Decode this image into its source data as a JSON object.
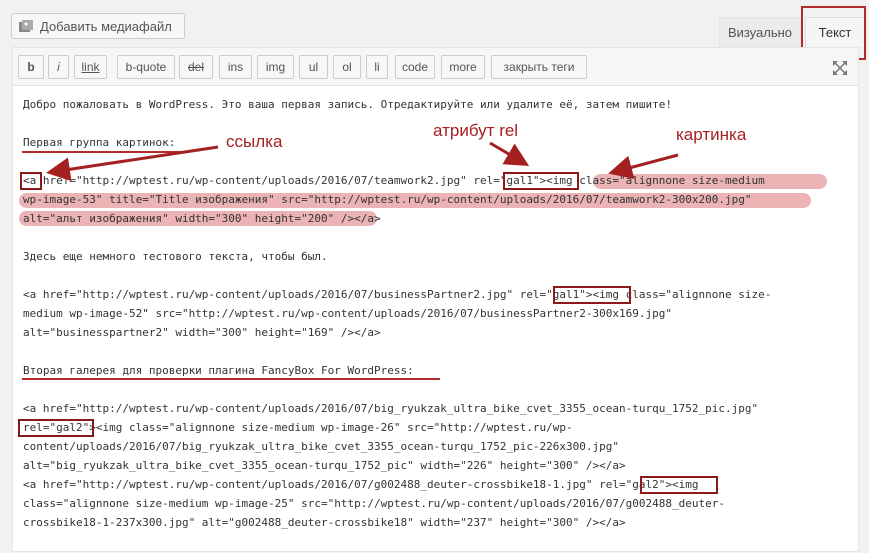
{
  "media_button": {
    "label": "Добавить медиафайл",
    "icon": "media-icon"
  },
  "tabs": [
    {
      "label": "Визуально"
    },
    {
      "label": "Текст"
    }
  ],
  "toolbar": {
    "buttons": [
      "b",
      "i",
      "link",
      "b-quote",
      "del",
      "ins",
      "img",
      "ul",
      "ol",
      "li",
      "code",
      "more",
      "закрыть теги"
    ]
  },
  "content": {
    "lines": [
      "Добро пожаловать в WordPress. Это ваша первая запись. Отредактируйте или удалите её, затем пишите!",
      "Первая группа картинок:",
      "<a href=\"http://wptest.ru/wp-content/uploads/2016/07/teamwork2.jpg\" rel=\"gal1\"><img class=\"alignnone size-medium",
      "wp-image-53\" title=\"Title изображения\" src=\"http://wptest.ru/wp-content/uploads/2016/07/teamwork2-300x200.jpg\"",
      "alt=\"альт изображения\" width=\"300\" height=\"200\" /></a>",
      "Здесь еще немного тестового текста, чтобы был.",
      "<a href=\"http://wptest.ru/wp-content/uploads/2016/07/businessPartner2.jpg\" rel=\"gal1\"><img class=\"alignnone size-",
      "medium wp-image-52\" src=\"http://wptest.ru/wp-content/uploads/2016/07/businessPartner2-300x169.jpg\"",
      "alt=\"businesspartner2\" width=\"300\" height=\"169\" /></a>",
      "Вторая галерея для проверки плагина FancyBox For WordPress:",
      "<a href=\"http://wptest.ru/wp-content/uploads/2016/07/big_ryukzak_ultra_bike_cvet_3355_ocean-turqu_1752_pic.jpg\"",
      "rel=\"gal2\"><img class=\"alignnone size-medium wp-image-26\" src=\"http://wptest.ru/wp-",
      "content/uploads/2016/07/big_ryukzak_ultra_bike_cvet_3355_ocean-turqu_1752_pic-226x300.jpg\"",
      "alt=\"big_ryukzak_ultra_bike_cvet_3355_ocean-turqu_1752_pic\" width=\"226\" height=\"300\" /></a>",
      "<a href=\"http://wptest.ru/wp-content/uploads/2016/07/g002488_deuter-crossbike18-1.jpg\" rel=\"gal2\"><img",
      "class=\"alignnone size-medium wp-image-25\" src=\"http://wptest.ru/wp-content/uploads/2016/07/g002488_deuter-",
      "crossbike18-1-237x300.jpg\" alt=\"g002488_deuter-crossbike18\" width=\"237\" height=\"300\" /></a>"
    ]
  },
  "annotations": {
    "link": "ссылка",
    "rel": "атрибут rel",
    "image": "картинка"
  },
  "colors": {
    "annotation": "#a52020",
    "highlight": "#e8a6a6",
    "tab_border": "#b52a2a"
  }
}
